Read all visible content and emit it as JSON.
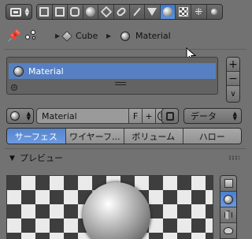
{
  "toolbar": {
    "editor_type_icon": "properties-editor-icon",
    "context_tabs": [
      {
        "name": "render-icon"
      },
      {
        "name": "render-layers-icon"
      },
      {
        "name": "scene-icon"
      },
      {
        "name": "world-icon"
      },
      {
        "name": "object-icon"
      },
      {
        "name": "constraints-icon"
      },
      {
        "name": "modifiers-icon"
      },
      {
        "name": "data-icon"
      },
      {
        "name": "material-icon",
        "active": true
      },
      {
        "name": "texture-icon"
      },
      {
        "name": "particles-icon"
      },
      {
        "name": "physics-icon"
      }
    ]
  },
  "breadcrumb": {
    "object": "Cube",
    "material": "Material"
  },
  "material_slots": {
    "items": [
      "Material"
    ],
    "add_label": "+",
    "remove_label": "−",
    "menu_label": "∨"
  },
  "material_selector": {
    "name": "Material",
    "fake_user_label": "F",
    "new_label": "+",
    "unlink_label": "×",
    "link_label": "データ"
  },
  "tabs": [
    {
      "label": "サーフェス",
      "active": true
    },
    {
      "label": "ワイヤーフ..."
    },
    {
      "label": "ボリューム"
    },
    {
      "label": "ハロー"
    }
  ],
  "preview_panel": {
    "title": "プレビュー"
  },
  "colors": {
    "background": "#727272",
    "accent": "#5680c2",
    "active_tab": "#5485cc"
  }
}
